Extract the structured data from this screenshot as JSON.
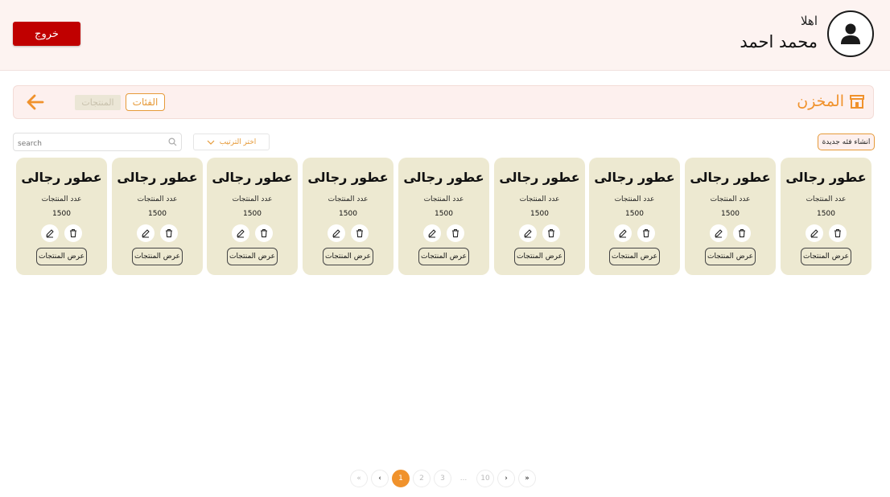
{
  "header": {
    "logout_label": "خروج",
    "greeting": "اهلا",
    "user_name": "محمد احمد"
  },
  "breadcrumb": {
    "title": "المخزن",
    "tab_categories": "الفئات",
    "tab_products": "المنتجات"
  },
  "toolbar": {
    "search_placeholder": "search",
    "sort_label": "اختر الترتيب",
    "new_category_label": "انشاء فئه جديدة"
  },
  "cards": [
    {
      "title": "عطور رجالى",
      "count_label": "عدد المنتجات",
      "count": "1500",
      "view_label": "عرض المنتجات"
    },
    {
      "title": "عطور رجالى",
      "count_label": "عدد المنتجات",
      "count": "1500",
      "view_label": "عرض المنتجات"
    },
    {
      "title": "عطور رجالى",
      "count_label": "عدد المنتجات",
      "count": "1500",
      "view_label": "عرض المنتجات"
    },
    {
      "title": "عطور رجالى",
      "count_label": "عدد المنتجات",
      "count": "1500",
      "view_label": "عرض المنتجات"
    },
    {
      "title": "عطور رجالى",
      "count_label": "عدد المنتجات",
      "count": "1500",
      "view_label": "عرض المنتجات"
    },
    {
      "title": "عطور رجالى",
      "count_label": "عدد المنتجات",
      "count": "1500",
      "view_label": "عرض المنتجات"
    },
    {
      "title": "عطور رجالى",
      "count_label": "عدد المنتجات",
      "count": "1500",
      "view_label": "عرض المنتجات"
    },
    {
      "title": "عطور رجالى",
      "count_label": "عدد المنتجات",
      "count": "1500",
      "view_label": "عرض المنتجات"
    },
    {
      "title": "عطور رجالى",
      "count_label": "عدد المنتجات",
      "count": "1500",
      "view_label": "عرض المنتجات"
    }
  ],
  "pagination": {
    "first": "«",
    "prev": "‹",
    "pages": [
      "1",
      "2",
      "3"
    ],
    "ellipsis": "...",
    "last_page": "10",
    "next": "›",
    "last": "»",
    "current": "1"
  },
  "colors": {
    "accent": "#f0922c",
    "logout": "#c00000",
    "card_bg": "#ede9d1",
    "header_bg": "#fdf3f1"
  },
  "icons": {
    "avatar": "user-icon",
    "back": "arrow-left-icon",
    "store": "store-icon",
    "search": "search-icon",
    "sort": "chevron-down-icon",
    "edit": "pencil-icon",
    "delete": "trash-icon"
  }
}
